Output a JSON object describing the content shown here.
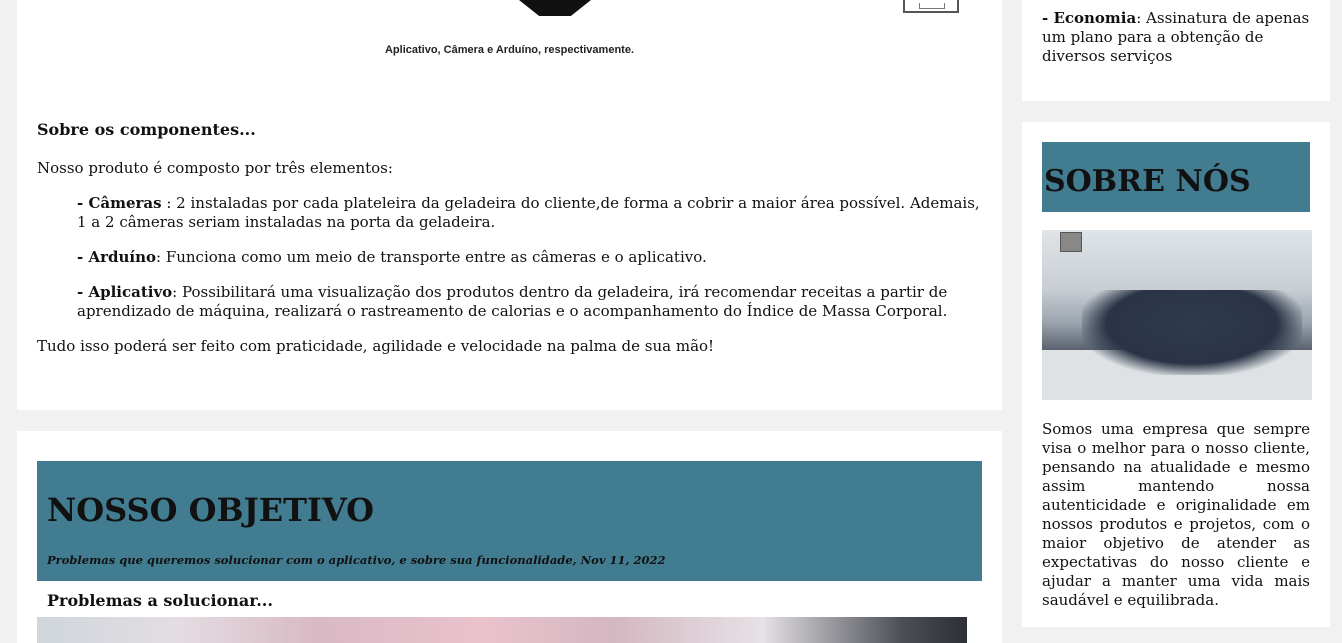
{
  "top_section": {
    "caption": "Aplicativo, Câmera e Arduíno, respectivamente.",
    "heading": "Sobre os componentes...",
    "intro": "Nosso produto é composto por três elementos:",
    "items": [
      {
        "term": "- Câmeras",
        "text": " : 2 instaladas por cada plateleira da geladeira do cliente,de forma a cobrir a maior área possível. Ademais, 1 a 2 câmeras seriam instaladas na porta da geladeira."
      },
      {
        "term": "- Arduíno",
        "text": ": Funciona como um meio de transporte entre as câmeras e o aplicativo."
      },
      {
        "term": "- Aplicativo",
        "text": ": Possibilitará uma visualização dos produtos dentro da geladeira, irá recomendar receitas a partir de aprendizado de máquina, realizará o rastreamento de calorias e o acompanhamento do Índice de Massa Corporal."
      }
    ],
    "closing": "Tudo isso poderá ser feito com praticidade, agilidade e velocidade na palma de sua mão!"
  },
  "objective_section": {
    "title": "NOSSO OBJETIVO",
    "subtitle": "Problemas que queremos solucionar com o aplicativo, e sobre sua funcionalidade, Nov 11, 2022",
    "problems_heading": "Problemas a solucionar..."
  },
  "sidebar": {
    "economy": {
      "term": "- Economia",
      "text": ": Assinatura de apenas um plano para a obtenção de diversos serviços"
    },
    "about": {
      "title": "SOBRE NÓS",
      "text": "Somos uma empresa que sempre visa o melhor para o nosso cliente, pensando na atualidade e mesmo assim mantendo nossa autenticidade e originalidade em nossos produtos e projetos, com o maior objetivo de atender as expectativas do nosso cliente e ajudar a manter uma vida mais saudável e equilibrada."
    }
  },
  "colors": {
    "banner": "#417c91",
    "page_bg": "#f1f1f1",
    "card_bg": "#ffffff"
  }
}
